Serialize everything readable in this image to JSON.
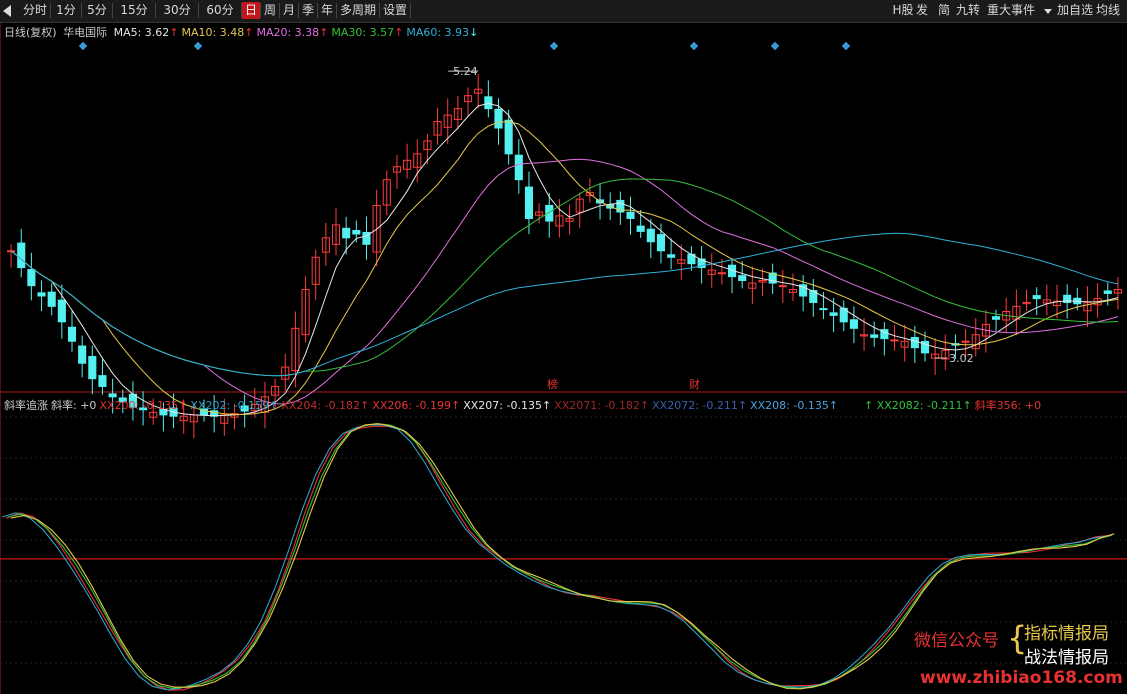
{
  "toolbar": {
    "periods": [
      "分时",
      "1分",
      "5分",
      "15分",
      "30分",
      "60分",
      "日",
      "周",
      "月",
      "季",
      "年",
      "多周期",
      "设置"
    ],
    "active": "日",
    "right": [
      "H股",
      "发",
      "简",
      "九转",
      "重大事件",
      "加自选",
      "均线"
    ]
  },
  "upper": {
    "legend": {
      "period": "日线(复权)",
      "stock": "华电国际",
      "ma": [
        {
          "label": "MA5: 3.62",
          "arrow": "↑",
          "color": "#e6e6e6"
        },
        {
          "label": "MA10: 3.48",
          "arrow": "↑",
          "color": "#e6c84a"
        },
        {
          "label": "MA20: 3.38",
          "arrow": "↑",
          "color": "#e070e0"
        },
        {
          "label": "MA30: 3.57",
          "arrow": "↑",
          "color": "#35c03a"
        },
        {
          "label": "MA60: 3.93",
          "arrow": "↓",
          "color": "#2fb0d8"
        }
      ]
    },
    "high_label": "5.24",
    "low_label": "3.02",
    "marker_bang": "榜",
    "marker_cai": "财"
  },
  "lower": {
    "legend_a": [
      {
        "label": "斜率追涨",
        "color": "#cccccc"
      },
      {
        "label": "斜率: +0",
        "color": "#cccccc"
      },
      {
        "label": "XX200: -0.135↑",
        "color": "#e83232"
      },
      {
        "label": "XX202: -0.159↑",
        "color": "#2fa0c8"
      },
      {
        "label": "XX204: -0.182↑",
        "color": "#c03030"
      },
      {
        "label": "XX206: -0.199↑",
        "color": "#e83232"
      },
      {
        "label": "XX207: -0.135↑",
        "color": "#e6e6e6"
      },
      {
        "label": "XX2071: -0.182↑",
        "color": "#a02828"
      },
      {
        "label": "XX2072: -0.211↑",
        "color": "#3a5fb0"
      },
      {
        "label": "XX208: -0.135↑",
        "color": "#4aa0e0"
      }
    ],
    "legend_b": [
      {
        "label": "↑ XX2082: -0.211↑",
        "color": "#35c03a"
      },
      {
        "label": "斜率356: +0",
        "color": "#e83232"
      }
    ]
  },
  "watermark": {
    "wx": "微信公众号",
    "name1": "指标情报局",
    "name2": "战法情报局",
    "url": "www.zhibiao168.com"
  },
  "colors": {
    "up": "#ff3c3c",
    "down": "#54f0f0",
    "zero_line": "#d01818"
  },
  "chart_data": [
    {
      "type": "candlestick",
      "ylim": [
        2.85,
        5.45
      ],
      "bars": 110,
      "close": [
        3.85,
        3.72,
        3.58,
        3.5,
        3.42,
        3.3,
        3.15,
        2.98,
        2.86,
        2.8,
        2.72,
        2.68,
        2.64,
        2.62,
        2.6,
        2.58,
        2.57,
        2.57,
        2.58,
        2.58,
        2.57,
        2.58,
        2.59,
        2.61,
        2.66,
        2.72,
        2.8,
        2.95,
        3.25,
        3.55,
        3.8,
        3.95,
        4.05,
        3.95,
        3.98,
        3.9,
        4.2,
        4.4,
        4.5,
        4.55,
        4.6,
        4.7,
        4.85,
        4.9,
        4.95,
        5.05,
        5.1,
        4.95,
        4.8,
        4.6,
        4.4,
        4.1,
        4.15,
        4.08,
        4.12,
        4.1,
        4.25,
        4.3,
        4.22,
        4.18,
        4.15,
        4.1,
        4.0,
        3.92,
        3.85,
        3.8,
        3.78,
        3.75,
        3.72,
        3.7,
        3.68,
        3.65,
        3.62,
        3.6,
        3.62,
        3.6,
        3.58,
        3.55,
        3.5,
        3.45,
        3.4,
        3.35,
        3.3,
        3.25,
        3.2,
        3.18,
        3.17,
        3.16,
        3.15,
        3.1,
        3.06,
        3.05,
        3.08,
        3.12,
        3.15,
        3.2,
        3.28,
        3.32,
        3.38,
        3.42,
        3.45,
        3.48,
        3.47,
        3.46,
        3.45,
        3.44,
        3.45,
        3.48,
        3.52,
        3.55
      ],
      "ma_series": [
        {
          "name": "MA5",
          "color": "#e6e6e6"
        },
        {
          "name": "MA10",
          "color": "#e6c84a"
        },
        {
          "name": "MA20",
          "color": "#e070e0"
        },
        {
          "name": "MA30",
          "color": "#35c03a"
        },
        {
          "name": "MA60",
          "color": "#2fb0d8"
        }
      ]
    },
    {
      "type": "line",
      "ylim": [
        -1.0,
        1.05
      ],
      "zero": 0,
      "x_count": 110,
      "series": [
        {
          "name": "XX200",
          "color": "#e83232"
        },
        {
          "name": "XX202",
          "color": "#2fa0c8"
        },
        {
          "name": "XX2082",
          "color": "#35c03a"
        },
        {
          "name": "XX207",
          "color": "#e6c84a"
        }
      ],
      "values": [
        0.3,
        0.33,
        0.3,
        0.22,
        0.1,
        -0.05,
        -0.22,
        -0.4,
        -0.58,
        -0.74,
        -0.86,
        -0.93,
        -0.96,
        -0.96,
        -0.94,
        -0.9,
        -0.84,
        -0.75,
        -0.62,
        -0.45,
        -0.22,
        0.05,
        0.35,
        0.62,
        0.82,
        0.94,
        0.98,
        0.99,
        0.98,
        0.95,
        0.86,
        0.72,
        0.55,
        0.38,
        0.22,
        0.1,
        0.02,
        -0.05,
        -0.1,
        -0.15,
        -0.2,
        -0.24,
        -0.27,
        -0.28,
        -0.3,
        -0.31,
        -0.32,
        -0.33,
        -0.35,
        -0.4,
        -0.47,
        -0.56,
        -0.65,
        -0.75,
        -0.83,
        -0.89,
        -0.93,
        -0.95,
        -0.95,
        -0.94,
        -0.92,
        -0.88,
        -0.82,
        -0.74,
        -0.64,
        -0.52,
        -0.38,
        -0.24,
        -0.12,
        -0.04,
        0.0,
        0.02,
        0.03,
        0.04,
        0.05,
        0.06,
        0.07,
        0.08,
        0.1,
        0.12,
        0.16,
        0.18
      ]
    }
  ]
}
